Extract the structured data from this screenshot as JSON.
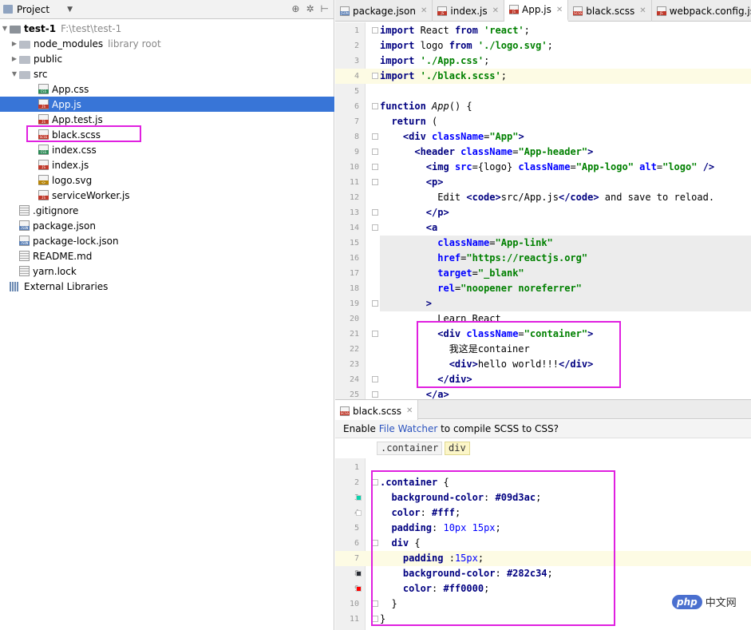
{
  "project_panel": {
    "title": "Project",
    "tools": [
      "⊕",
      "✲",
      "⊢"
    ],
    "tree": [
      {
        "name": "test-1",
        "extra": "F:\\test\\test-1",
        "kind": "folder-root",
        "depth": 0,
        "arrow": "▼"
      },
      {
        "name": "node_modules",
        "extra": "library root",
        "kind": "folder",
        "depth": 1,
        "arrow": "▶"
      },
      {
        "name": "public",
        "kind": "folder",
        "depth": 1,
        "arrow": "▶"
      },
      {
        "name": "src",
        "kind": "folder",
        "depth": 1,
        "arrow": "▼"
      },
      {
        "name": "App.css",
        "kind": "css",
        "depth": 2
      },
      {
        "name": "App.js",
        "kind": "js",
        "depth": 2,
        "selected": true
      },
      {
        "name": "App.test.js",
        "kind": "js",
        "depth": 2
      },
      {
        "name": "black.scss",
        "kind": "scss",
        "depth": 2,
        "boxed": true
      },
      {
        "name": "index.css",
        "kind": "css",
        "depth": 2
      },
      {
        "name": "index.js",
        "kind": "js",
        "depth": 2
      },
      {
        "name": "logo.svg",
        "kind": "svg",
        "depth": 2
      },
      {
        "name": "serviceWorker.js",
        "kind": "js",
        "depth": 2
      },
      {
        "name": ".gitignore",
        "kind": "text",
        "depth": 1
      },
      {
        "name": "package.json",
        "kind": "json",
        "depth": 1
      },
      {
        "name": "package-lock.json",
        "kind": "json",
        "depth": 1
      },
      {
        "name": "README.md",
        "kind": "text",
        "depth": 1
      },
      {
        "name": "yarn.lock",
        "kind": "text",
        "depth": 1
      },
      {
        "name": "External Libraries",
        "kind": "lib",
        "depth": 0
      }
    ]
  },
  "editor_tabs": [
    {
      "label": "package.json",
      "badge": "JSON",
      "badge_color": "#5a7fb5"
    },
    {
      "label": "index.js",
      "badge": "JS",
      "badge_color": "#c0392b"
    },
    {
      "label": "App.js",
      "badge": "JS",
      "badge_color": "#c0392b",
      "active": true
    },
    {
      "label": "black.scss",
      "badge": "SCSS",
      "badge_color": "#c0392b"
    },
    {
      "label": "webpack.config.js",
      "badge": "JS",
      "badge_color": "#c0392b"
    }
  ],
  "appjs_lines": [
    {
      "n": "1",
      "html": "<span class='kw'>import</span> React <span class='kw'>from</span> <span class='str'>'react'</span>;"
    },
    {
      "n": "2",
      "html": "<span class='kw'>import</span> logo <span class='kw'>from</span> <span class='str'>'./logo.svg'</span>;"
    },
    {
      "n": "3",
      "html": "<span class='kw'>import</span> <span class='str'>'./App.css'</span>;"
    },
    {
      "n": "4",
      "html": "<span class='kw'>import</span> <span class='str'>'./black.scss'</span>;"
    },
    {
      "n": "5",
      "html": ""
    },
    {
      "n": "6",
      "html": "<span class='kw'>function</span> <span class='fn'>App</span>() {"
    },
    {
      "n": "7",
      "html": "  <span class='kw'>return</span> ("
    },
    {
      "n": "8",
      "html": "    <span class='tag'>&lt;div</span> <span class='attr'>className</span>=<span class='str'>\"App\"</span><span class='tag'>&gt;</span>"
    },
    {
      "n": "9",
      "html": "      <span class='tag'>&lt;header</span> <span class='attr'>className</span>=<span class='str'>\"App-header\"</span><span class='tag'>&gt;</span>"
    },
    {
      "n": "10",
      "html": "        <span class='tag'>&lt;img</span> <span class='attr'>src</span>={logo} <span class='attr'>className</span>=<span class='str'>\"App-logo\"</span> <span class='attr'>alt</span>=<span class='str'>\"logo\"</span> <span class='tag'>/&gt;</span>"
    },
    {
      "n": "11",
      "html": "        <span class='tag'>&lt;p&gt;</span>"
    },
    {
      "n": "12",
      "html": "          Edit <span class='tag'>&lt;code&gt;</span>src/App.js<span class='tag'>&lt;/code&gt;</span> and save to reload."
    },
    {
      "n": "13",
      "html": "        <span class='tag'>&lt;/p&gt;</span>"
    },
    {
      "n": "14",
      "html": "        <span class='tag'>&lt;a</span>"
    },
    {
      "n": "15",
      "html": "          <span class='attr'>className</span>=<span class='str'>\"App-link\"</span>"
    },
    {
      "n": "16",
      "html": "          <span class='attr'>href</span>=<span class='str'>\"https://reactjs.org\"</span>"
    },
    {
      "n": "17",
      "html": "          <span class='attr'>target</span>=<span class='str'>\"_blank\"</span>"
    },
    {
      "n": "18",
      "html": "          <span class='attr'>rel</span>=<span class='str'>\"noopener noreferrer\"</span>"
    },
    {
      "n": "19",
      "html": "        <span class='tag'>&gt;</span>"
    },
    {
      "n": "20",
      "html": "          Learn React"
    },
    {
      "n": "21",
      "html": "          <span class='tag'>&lt;div</span> <span class='attr'>className</span>=<span class='str'>\"container\"</span><span class='tag'>&gt;</span>"
    },
    {
      "n": "22",
      "html": "            我这是container"
    },
    {
      "n": "23",
      "html": "            <span class='tag'>&lt;div&gt;</span>hello world!!!<span class='tag'>&lt;/div&gt;</span>"
    },
    {
      "n": "24",
      "html": "          <span class='tag'>&lt;/div&gt;</span>"
    },
    {
      "n": "25",
      "html": "        <span class='tag'>&lt;/a&gt;</span>"
    }
  ],
  "bottom_tab": {
    "label": "black.scss",
    "badge": "SCSS"
  },
  "notification": {
    "before": "Enable ",
    "link": "File Watcher",
    "after": " to compile SCSS to CSS?"
  },
  "breadcrumb": [
    ".container",
    "div"
  ],
  "scss_lines": [
    {
      "n": "1",
      "html": ""
    },
    {
      "n": "2",
      "html": "<span class='sel2'>.container</span> {"
    },
    {
      "n": "3",
      "html": "  <span class='prop'>background-color</span>: <span class='hex'>#09d3ac</span>;",
      "swatch": "#09d3ac"
    },
    {
      "n": "4",
      "html": "  <span class='prop'>color</span>: <span class='hex'>#fff</span>;",
      "swatch": "#ffffff"
    },
    {
      "n": "5",
      "html": "  <span class='prop'>padding</span>: <span class='num'>10px</span> <span class='num'>15px</span>;"
    },
    {
      "n": "6",
      "html": "  <span class='sel2'>div</span> {"
    },
    {
      "n": "7",
      "html": "    <span class='prop'>padding</span> :<span class='num'>15px</span>;"
    },
    {
      "n": "8",
      "html": "    <span class='prop'>background-color</span>: <span class='hex'>#282c34</span>;",
      "swatch": "#282c34"
    },
    {
      "n": "9",
      "html": "    <span class='prop'>color</span>: <span class='hex'>#ff0000</span>;",
      "swatch": "#ff0000"
    },
    {
      "n": "10",
      "html": "  }"
    },
    {
      "n": "11",
      "html": "}"
    }
  ],
  "watermark": {
    "logo": "php",
    "text": "中文网"
  }
}
